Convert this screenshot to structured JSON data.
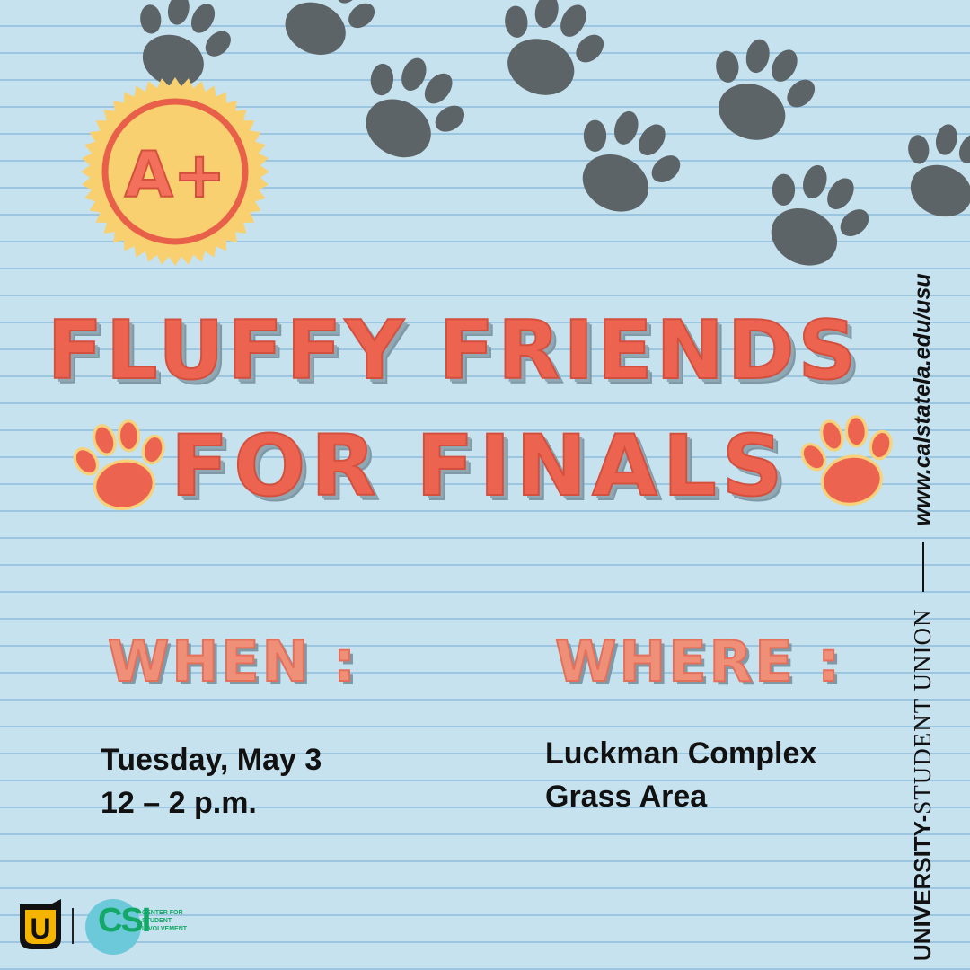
{
  "title": {
    "line1": "FLUFFY FRIENDS",
    "line2": "FOR FINALS"
  },
  "badge": {
    "text": "A+"
  },
  "when": {
    "label": "WHEN :",
    "line1": "Tuesday, May 3",
    "line2": "12 – 2 p.m."
  },
  "where": {
    "label": "WHERE :",
    "line1": "Luckman Complex",
    "line2": "Grass Area"
  },
  "sidebar": {
    "org_strong": "UNIVERSITY-",
    "org_rest": "STUDENT UNION",
    "website": "www.calstatela.edu/usu"
  },
  "logos": {
    "usu_letter": "U",
    "csi_letters": "CSI",
    "csi_name": "CENTER FOR STUDENT INVOLVEMENT"
  },
  "colors": {
    "paper": "#c6e2ee",
    "rule_lines": "#9cc6df",
    "title_red": "#ec6450",
    "title_inline_yellow": "#f7d27a",
    "label_salmon": "#f08f77",
    "paw_gray": "#5d6467",
    "badge_yellow": "#f9d06f",
    "csi_green": "#13a868",
    "csi_circle": "#6cc9d9"
  },
  "icons": [
    "paw-print-icon",
    "a-plus-badge-icon",
    "ball-icon",
    "usu-logo-icon",
    "csi-logo-icon"
  ]
}
